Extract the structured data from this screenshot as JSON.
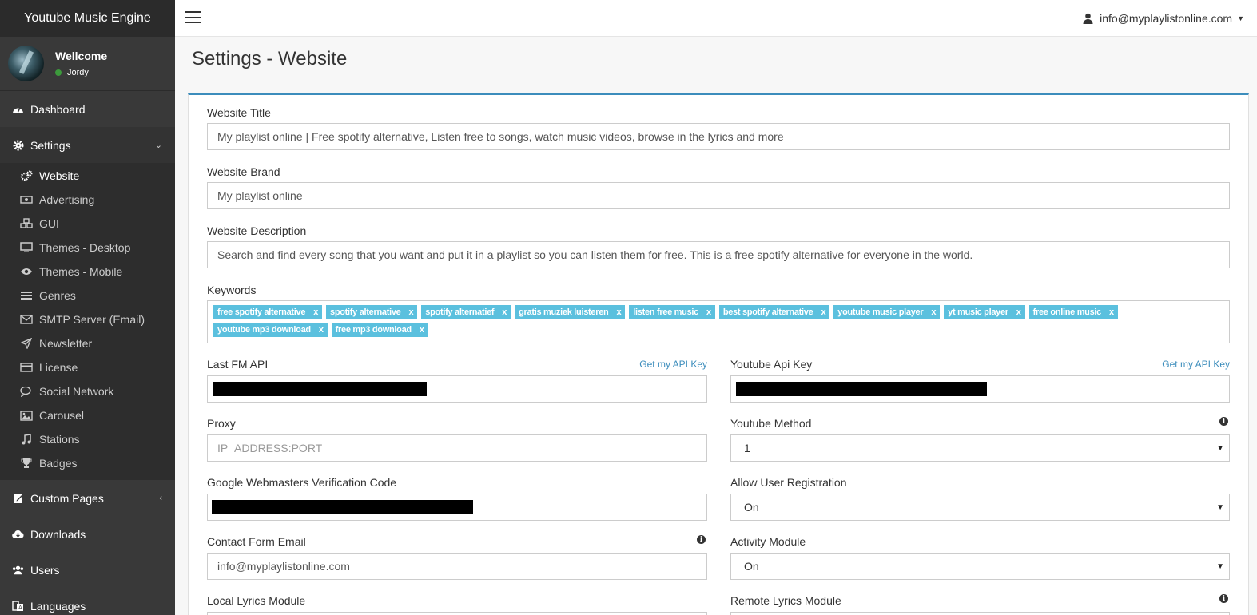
{
  "app": {
    "brand": "Youtube Music Engine"
  },
  "user": {
    "welcome": "Wellcome",
    "name": "Jordy"
  },
  "account": {
    "email": "info@myplaylistonline.com"
  },
  "sidebar": {
    "dashboard": "Dashboard",
    "settings": "Settings",
    "settings_items": [
      {
        "label": "Website",
        "icon": "cogs-icon"
      },
      {
        "label": "Advertising",
        "icon": "money-icon"
      },
      {
        "label": "GUI",
        "icon": "cubes-icon"
      },
      {
        "label": "Themes - Desktop",
        "icon": "desktop-icon"
      },
      {
        "label": "Themes - Mobile",
        "icon": "eye-icon"
      },
      {
        "label": "Genres",
        "icon": "list-icon"
      },
      {
        "label": "SMTP Server (Email)",
        "icon": "envelope-icon"
      },
      {
        "label": "Newsletter",
        "icon": "paper-plane-icon"
      },
      {
        "label": "License",
        "icon": "credit-card-icon"
      },
      {
        "label": "Social Network",
        "icon": "comments-icon"
      },
      {
        "label": "Carousel",
        "icon": "image-icon"
      },
      {
        "label": "Stations",
        "icon": "music-icon"
      },
      {
        "label": "Badges",
        "icon": "trophy-icon"
      }
    ],
    "custom_pages": "Custom Pages",
    "downloads": "Downloads",
    "users": "Users",
    "languages": "Languages"
  },
  "page": {
    "title": "Settings - Website"
  },
  "form": {
    "website_title": {
      "label": "Website Title",
      "value": "My playlist online | Free spotify alternative, Listen free to songs, watch music videos, browse in the lyrics and more"
    },
    "website_brand": {
      "label": "Website Brand",
      "value": "My playlist online"
    },
    "website_description": {
      "label": "Website Description",
      "value": "Search and find every song that you want and put it in a playlist so you can listen them for free. This is a free spotify alternative for everyone in the world."
    },
    "keywords": {
      "label": "Keywords",
      "tags": [
        "free spotify alternative",
        "spotify alternative",
        "spotify alternatief",
        "gratis muziek luisteren",
        "listen free music",
        "best spotify alternative",
        "youtube music player",
        "yt music player",
        "free online music",
        "youtube mp3 download",
        "free mp3 download"
      ],
      "remove": "x"
    },
    "lastfm_api": {
      "label": "Last FM API",
      "link": "Get my API Key"
    },
    "youtube_api": {
      "label": "Youtube Api Key",
      "link": "Get my API Key"
    },
    "proxy": {
      "label": "Proxy",
      "placeholder": "IP_ADDRESS:PORT"
    },
    "youtube_method": {
      "label": "Youtube Method",
      "value": "1"
    },
    "google_verification": {
      "label": "Google Webmasters Verification Code"
    },
    "allow_registration": {
      "label": "Allow User Registration",
      "value": "On"
    },
    "contact_email": {
      "label": "Contact Form Email",
      "value": "info@myplaylistonline.com"
    },
    "activity_module": {
      "label": "Activity Module",
      "value": "On"
    },
    "local_lyrics": {
      "label": "Local Lyrics Module"
    },
    "remote_lyrics": {
      "label": "Remote Lyrics Module"
    }
  }
}
